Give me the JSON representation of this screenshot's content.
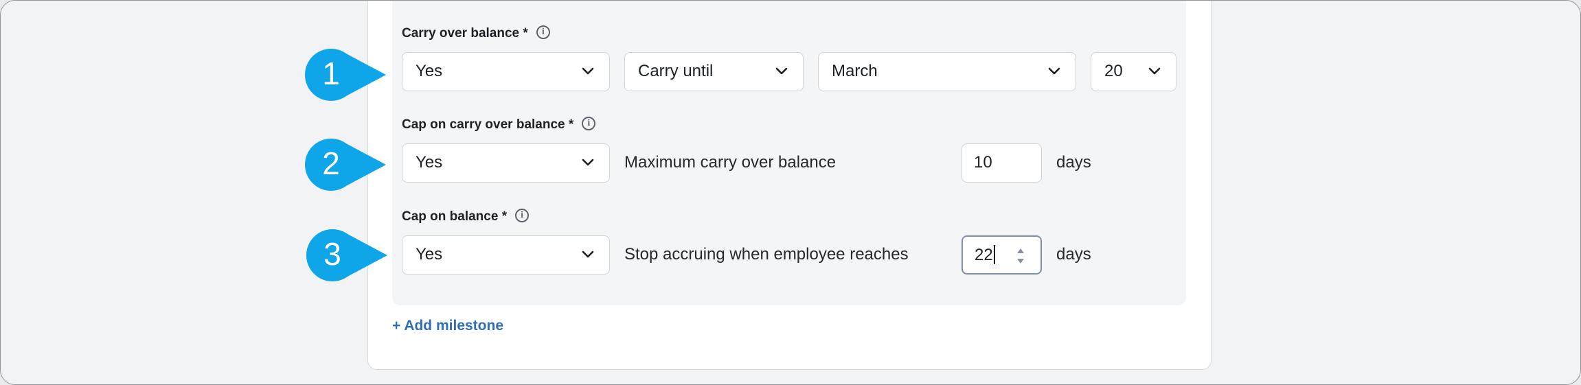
{
  "rows": [
    {
      "label": "Carry over balance *",
      "callout": "1",
      "selects": [
        "Yes",
        "Carry until",
        "March",
        "20"
      ]
    },
    {
      "label": "Cap on carry over balance *",
      "callout": "2",
      "select": "Yes",
      "text": "Maximum carry over balance",
      "value": "10",
      "unit": "days"
    },
    {
      "label": "Cap on balance *",
      "callout": "3",
      "select": "Yes",
      "text": "Stop accruing when employee reaches",
      "value": "22",
      "unit": "days"
    }
  ],
  "add_milestone": "+ Add milestone",
  "colors": {
    "callout": "#0ea5e9",
    "link": "#2f6fb2",
    "panel": "#ffffff",
    "inner_panel": "#f3f5f7"
  },
  "icons": {
    "info": "info-icon",
    "chevron": "chevron-down-icon",
    "spinner": "number-spinner-icon"
  }
}
